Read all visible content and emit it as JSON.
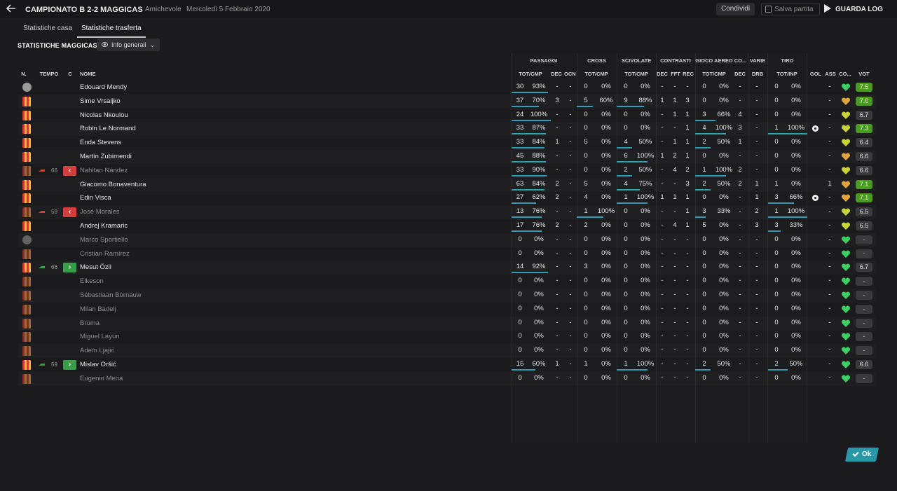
{
  "header": {
    "match_title": "CAMPIONATO B 2-2 MAGGICAS",
    "match_type": "Amichevole",
    "match_date": "Mercoledì 5 Febbraio 2020",
    "share_label": "Condividi",
    "save_label": "Salva partita",
    "continue_label": "GUARDA LOG"
  },
  "tabs": [
    {
      "label": "Statistiche casa",
      "active": false
    },
    {
      "label": "Statistiche trasferta",
      "active": true
    }
  ],
  "section": {
    "title": "STATISTICHE MAGGICAS",
    "view_selector": "Info generali"
  },
  "columns": {
    "player": {
      "n": "N.",
      "tempo": "TEMPO",
      "c": "C",
      "nome": "NOME"
    },
    "groups": {
      "passaggi": "PASSAGGI",
      "cross": "CROSS",
      "scivolate": "SCIVOLATE",
      "contrasti": "CONTRASTI",
      "gioco_aereo": "GIOCO AEREO",
      "co": "CO...",
      "varie": "VARIE",
      "tiro": "TIRO"
    },
    "sub": {
      "p_totcmp": "TOT/CMP",
      "p_dec": "DEC",
      "p_ocn": "OCN",
      "c_totcmp": "TOT/CMP",
      "s_totcmp": "TOT/CMP",
      "t_dec": "DEC",
      "t_fft": "FFT",
      "t_rec": "REC",
      "a_totcmp": "TOT/CMP",
      "co_dec": "DEC",
      "drb": "DRB",
      "tiro": "TOT/INP",
      "gol": "GOL",
      "ass": "ASS",
      "co": "CO...",
      "vot": "VOT"
    }
  },
  "players": [
    {
      "name": "Edouard Mendy",
      "gk": true,
      "sub": false,
      "pas": [
        30,
        "93%",
        0.93
      ],
      "dec": "-",
      "ocn": "-",
      "cross": [
        0,
        "0%",
        0
      ],
      "sciv": [
        0,
        "0%",
        0
      ],
      "cdec": "-",
      "fft": "-",
      "rec": "-",
      "aer": [
        0,
        "0%",
        0
      ],
      "codec": "-",
      "drb": "-",
      "tiro": [
        0,
        "0%",
        0
      ],
      "gol": "",
      "ass": "-",
      "heart": "green",
      "vot": "7.5",
      "vot_style": "green"
    },
    {
      "name": "Sime Vrsaljko",
      "gk": false,
      "sub": false,
      "pas": [
        37,
        "70%",
        0.7
      ],
      "dec": "3",
      "ocn": "-",
      "cross": [
        5,
        "60%",
        0.6
      ],
      "sciv": [
        9,
        "88%",
        0.88
      ],
      "cdec": "1",
      "fft": "1",
      "rec": "3",
      "aer": [
        0,
        "0%",
        0
      ],
      "codec": "-",
      "drb": "-",
      "tiro": [
        0,
        "0%",
        0
      ],
      "gol": "",
      "ass": "-",
      "heart": "orange",
      "vot": "7.0",
      "vot_style": "green"
    },
    {
      "name": "Nicolas Nkoulou",
      "gk": false,
      "sub": false,
      "pas": [
        24,
        "100%",
        1
      ],
      "dec": "-",
      "ocn": "-",
      "cross": [
        0,
        "0%",
        0
      ],
      "sciv": [
        0,
        "0%",
        0
      ],
      "cdec": "-",
      "fft": "1",
      "rec": "1",
      "aer": [
        3,
        "66%",
        0.66
      ],
      "codec": "4",
      "drb": "-",
      "tiro": [
        0,
        "0%",
        0
      ],
      "gol": "",
      "ass": "-",
      "heart": "yellow",
      "vot": "6.7",
      "vot_style": "grey"
    },
    {
      "name": "Robin Le Normand",
      "gk": false,
      "sub": false,
      "pas": [
        33,
        "87%",
        0.87
      ],
      "dec": "-",
      "ocn": "-",
      "cross": [
        0,
        "0%",
        0
      ],
      "sciv": [
        0,
        "0%",
        0
      ],
      "cdec": "-",
      "fft": "-",
      "rec": "1",
      "aer": [
        4,
        "100%",
        1
      ],
      "codec": "3",
      "drb": "-",
      "tiro": [
        1,
        "100%",
        1
      ],
      "gol": "ball",
      "ass": "-",
      "heart": "yellow",
      "vot": "7.3",
      "vot_style": "green"
    },
    {
      "name": "Enda Stevens",
      "gk": false,
      "sub": false,
      "pas": [
        33,
        "84%",
        0.84
      ],
      "dec": "1",
      "ocn": "-",
      "cross": [
        5,
        "0%",
        0
      ],
      "sciv": [
        4,
        "50%",
        0.5
      ],
      "cdec": "-",
      "fft": "1",
      "rec": "1",
      "aer": [
        2,
        "50%",
        0.5
      ],
      "codec": "1",
      "drb": "-",
      "tiro": [
        0,
        "0%",
        0
      ],
      "gol": "",
      "ass": "-",
      "heart": "yellow",
      "vot": "6.4",
      "vot_style": "grey"
    },
    {
      "name": "Martín Zubimendi",
      "gk": false,
      "sub": false,
      "pas": [
        45,
        "88%",
        0.88
      ],
      "dec": "-",
      "ocn": "-",
      "cross": [
        0,
        "0%",
        0
      ],
      "sciv": [
        6,
        "100%",
        1
      ],
      "cdec": "1",
      "fft": "2",
      "rec": "1",
      "aer": [
        0,
        "0%",
        0
      ],
      "codec": "-",
      "drb": "-",
      "tiro": [
        0,
        "0%",
        0
      ],
      "gol": "",
      "ass": "-",
      "heart": "orange",
      "vot": "6.6",
      "vot_style": "grey"
    },
    {
      "name": "Nahitan Nández",
      "gk": false,
      "sub": true,
      "minute": "66",
      "chip": "out",
      "pas": [
        33,
        "90%",
        0.9
      ],
      "dec": "-",
      "ocn": "-",
      "cross": [
        0,
        "0%",
        0
      ],
      "sciv": [
        2,
        "50%",
        0.5
      ],
      "cdec": "-",
      "fft": "4",
      "rec": "2",
      "aer": [
        1,
        "100%",
        1
      ],
      "codec": "2",
      "drb": "-",
      "tiro": [
        0,
        "0%",
        0
      ],
      "gol": "",
      "ass": "-",
      "heart": "yellow",
      "vot": "6.6",
      "vot_style": "grey"
    },
    {
      "name": "Giacomo Bonaventura",
      "gk": false,
      "sub": false,
      "pas": [
        63,
        "84%",
        0.84
      ],
      "dec": "2",
      "ocn": "-",
      "cross": [
        5,
        "0%",
        0
      ],
      "sciv": [
        4,
        "75%",
        0.75
      ],
      "cdec": "-",
      "fft": "-",
      "rec": "3",
      "aer": [
        2,
        "50%",
        0.5
      ],
      "codec": "2",
      "drb": "1",
      "tiro": [
        1,
        "0%",
        0
      ],
      "gol": "",
      "ass": "1",
      "heart": "orange",
      "vot": "7.1",
      "vot_style": "green"
    },
    {
      "name": "Edin Visca",
      "gk": false,
      "sub": false,
      "pas": [
        27,
        "62%",
        0.62
      ],
      "dec": "2",
      "ocn": "-",
      "cross": [
        4,
        "0%",
        0
      ],
      "sciv": [
        1,
        "100%",
        1
      ],
      "cdec": "1",
      "fft": "1",
      "rec": "1",
      "aer": [
        0,
        "0%",
        0
      ],
      "codec": "-",
      "drb": "1",
      "tiro": [
        3,
        "66%",
        0.66
      ],
      "gol": "ball",
      "ass": "-",
      "heart": "orange",
      "vot": "7.1",
      "vot_style": "green"
    },
    {
      "name": "José Morales",
      "gk": false,
      "sub": true,
      "minute": "59",
      "chip": "out",
      "pas": [
        13,
        "76%",
        0.76
      ],
      "dec": "-",
      "ocn": "-",
      "cross": [
        1,
        "100%",
        1
      ],
      "sciv": [
        0,
        "0%",
        0
      ],
      "cdec": "-",
      "fft": "-",
      "rec": "1",
      "aer": [
        3,
        "33%",
        0.33
      ],
      "codec": "-",
      "drb": "2",
      "tiro": [
        1,
        "100%",
        1
      ],
      "gol": "",
      "ass": "-",
      "heart": "yellow",
      "vot": "6.5",
      "vot_style": "grey"
    },
    {
      "name": "Andrej Kramaric",
      "gk": false,
      "sub": false,
      "pas": [
        17,
        "76%",
        0.76
      ],
      "dec": "2",
      "ocn": "-",
      "cross": [
        2,
        "0%",
        0
      ],
      "sciv": [
        0,
        "0%",
        0
      ],
      "cdec": "-",
      "fft": "4",
      "rec": "1",
      "aer": [
        5,
        "0%",
        0
      ],
      "codec": "-",
      "drb": "3",
      "tiro": [
        3,
        "33%",
        0.33
      ],
      "gol": "",
      "ass": "-",
      "heart": "yellow",
      "vot": "6.5",
      "vot_style": "grey"
    },
    {
      "name": "Marco Sportiello",
      "gk": true,
      "sub": true,
      "pas": [
        0,
        "0%",
        0
      ],
      "dec": "-",
      "ocn": "-",
      "cross": [
        0,
        "0%",
        0
      ],
      "sciv": [
        0,
        "0%",
        0
      ],
      "cdec": "-",
      "fft": "-",
      "rec": "-",
      "aer": [
        0,
        "0%",
        0
      ],
      "codec": "-",
      "drb": "-",
      "tiro": [
        0,
        "0%",
        0
      ],
      "gol": "",
      "ass": "-",
      "heart": "green",
      "vot": "-",
      "vot_style": "empty"
    },
    {
      "name": "Cristian Ramírez",
      "gk": false,
      "sub": true,
      "pas": [
        0,
        "0%",
        0
      ],
      "dec": "-",
      "ocn": "-",
      "cross": [
        0,
        "0%",
        0
      ],
      "sciv": [
        0,
        "0%",
        0
      ],
      "cdec": "-",
      "fft": "-",
      "rec": "-",
      "aer": [
        0,
        "0%",
        0
      ],
      "codec": "-",
      "drb": "-",
      "tiro": [
        0,
        "0%",
        0
      ],
      "gol": "",
      "ass": "-",
      "heart": "green",
      "vot": "-",
      "vot_style": "empty"
    },
    {
      "name": "Mesut Özil",
      "gk": false,
      "sub": false,
      "minute": "66",
      "chip": "in",
      "pas": [
        14,
        "92%",
        0.92
      ],
      "dec": "-",
      "ocn": "-",
      "cross": [
        3,
        "0%",
        0
      ],
      "sciv": [
        0,
        "0%",
        0
      ],
      "cdec": "-",
      "fft": "-",
      "rec": "-",
      "aer": [
        0,
        "0%",
        0
      ],
      "codec": "-",
      "drb": "-",
      "tiro": [
        0,
        "0%",
        0
      ],
      "gol": "",
      "ass": "-",
      "heart": "green",
      "vot": "6.7",
      "vot_style": "grey"
    },
    {
      "name": "Elkeson",
      "gk": false,
      "sub": true,
      "pas": [
        0,
        "0%",
        0
      ],
      "dec": "-",
      "ocn": "-",
      "cross": [
        0,
        "0%",
        0
      ],
      "sciv": [
        0,
        "0%",
        0
      ],
      "cdec": "-",
      "fft": "-",
      "rec": "-",
      "aer": [
        0,
        "0%",
        0
      ],
      "codec": "-",
      "drb": "-",
      "tiro": [
        0,
        "0%",
        0
      ],
      "gol": "",
      "ass": "-",
      "heart": "green",
      "vot": "-",
      "vot_style": "empty"
    },
    {
      "name": "Sébastiaan Bornauw",
      "gk": false,
      "sub": true,
      "pas": [
        0,
        "0%",
        0
      ],
      "dec": "-",
      "ocn": "-",
      "cross": [
        0,
        "0%",
        0
      ],
      "sciv": [
        0,
        "0%",
        0
      ],
      "cdec": "-",
      "fft": "-",
      "rec": "-",
      "aer": [
        0,
        "0%",
        0
      ],
      "codec": "-",
      "drb": "-",
      "tiro": [
        0,
        "0%",
        0
      ],
      "gol": "",
      "ass": "-",
      "heart": "green",
      "vot": "-",
      "vot_style": "empty"
    },
    {
      "name": "Milan Badelj",
      "gk": false,
      "sub": true,
      "pas": [
        0,
        "0%",
        0
      ],
      "dec": "-",
      "ocn": "-",
      "cross": [
        0,
        "0%",
        0
      ],
      "sciv": [
        0,
        "0%",
        0
      ],
      "cdec": "-",
      "fft": "-",
      "rec": "-",
      "aer": [
        0,
        "0%",
        0
      ],
      "codec": "-",
      "drb": "-",
      "tiro": [
        0,
        "0%",
        0
      ],
      "gol": "",
      "ass": "-",
      "heart": "green",
      "vot": "-",
      "vot_style": "empty"
    },
    {
      "name": "Bruma",
      "gk": false,
      "sub": true,
      "pas": [
        0,
        "0%",
        0
      ],
      "dec": "-",
      "ocn": "-",
      "cross": [
        0,
        "0%",
        0
      ],
      "sciv": [
        0,
        "0%",
        0
      ],
      "cdec": "-",
      "fft": "-",
      "rec": "-",
      "aer": [
        0,
        "0%",
        0
      ],
      "codec": "-",
      "drb": "-",
      "tiro": [
        0,
        "0%",
        0
      ],
      "gol": "",
      "ass": "-",
      "heart": "green",
      "vot": "-",
      "vot_style": "empty"
    },
    {
      "name": "Miguel Layún",
      "gk": false,
      "sub": true,
      "pas": [
        0,
        "0%",
        0
      ],
      "dec": "-",
      "ocn": "-",
      "cross": [
        0,
        "0%",
        0
      ],
      "sciv": [
        0,
        "0%",
        0
      ],
      "cdec": "-",
      "fft": "-",
      "rec": "-",
      "aer": [
        0,
        "0%",
        0
      ],
      "codec": "-",
      "drb": "-",
      "tiro": [
        0,
        "0%",
        0
      ],
      "gol": "",
      "ass": "-",
      "heart": "green",
      "vot": "-",
      "vot_style": "empty"
    },
    {
      "name": "Adem Ljajić",
      "gk": false,
      "sub": true,
      "pas": [
        0,
        "0%",
        0
      ],
      "dec": "-",
      "ocn": "-",
      "cross": [
        0,
        "0%",
        0
      ],
      "sciv": [
        0,
        "0%",
        0
      ],
      "cdec": "-",
      "fft": "-",
      "rec": "-",
      "aer": [
        0,
        "0%",
        0
      ],
      "codec": "-",
      "drb": "-",
      "tiro": [
        0,
        "0%",
        0
      ],
      "gol": "",
      "ass": "-",
      "heart": "green",
      "vot": "-",
      "vot_style": "empty"
    },
    {
      "name": "Mislav Oršić",
      "gk": false,
      "sub": false,
      "minute": "59",
      "chip": "in",
      "pas": [
        15,
        "60%",
        0.6
      ],
      "dec": "1",
      "ocn": "-",
      "cross": [
        1,
        "0%",
        0
      ],
      "sciv": [
        1,
        "100%",
        1
      ],
      "cdec": "-",
      "fft": "-",
      "rec": "-",
      "aer": [
        2,
        "50%",
        0.5
      ],
      "codec": "-",
      "drb": "-",
      "tiro": [
        2,
        "50%",
        0.5
      ],
      "gol": "",
      "ass": "-",
      "heart": "green",
      "vot": "6.6",
      "vot_style": "grey"
    },
    {
      "name": "Eugenio Mena",
      "gk": false,
      "sub": true,
      "pas": [
        0,
        "0%",
        0
      ],
      "dec": "-",
      "ocn": "-",
      "cross": [
        0,
        "0%",
        0
      ],
      "sciv": [
        0,
        "0%",
        0
      ],
      "cdec": "-",
      "fft": "-",
      "rec": "-",
      "aer": [
        0,
        "0%",
        0
      ],
      "codec": "-",
      "drb": "-",
      "tiro": [
        0,
        "0%",
        0
      ],
      "gol": "",
      "ass": "-",
      "heart": "green",
      "vot": "-",
      "vot_style": "empty"
    }
  ],
  "footer": {
    "ok_label": "Ok"
  },
  "colors": {
    "accent": "#2d9fb8",
    "rating_green": "#4a9b22",
    "out_red": "#d13f3f",
    "in_green": "#3a9d4a"
  }
}
